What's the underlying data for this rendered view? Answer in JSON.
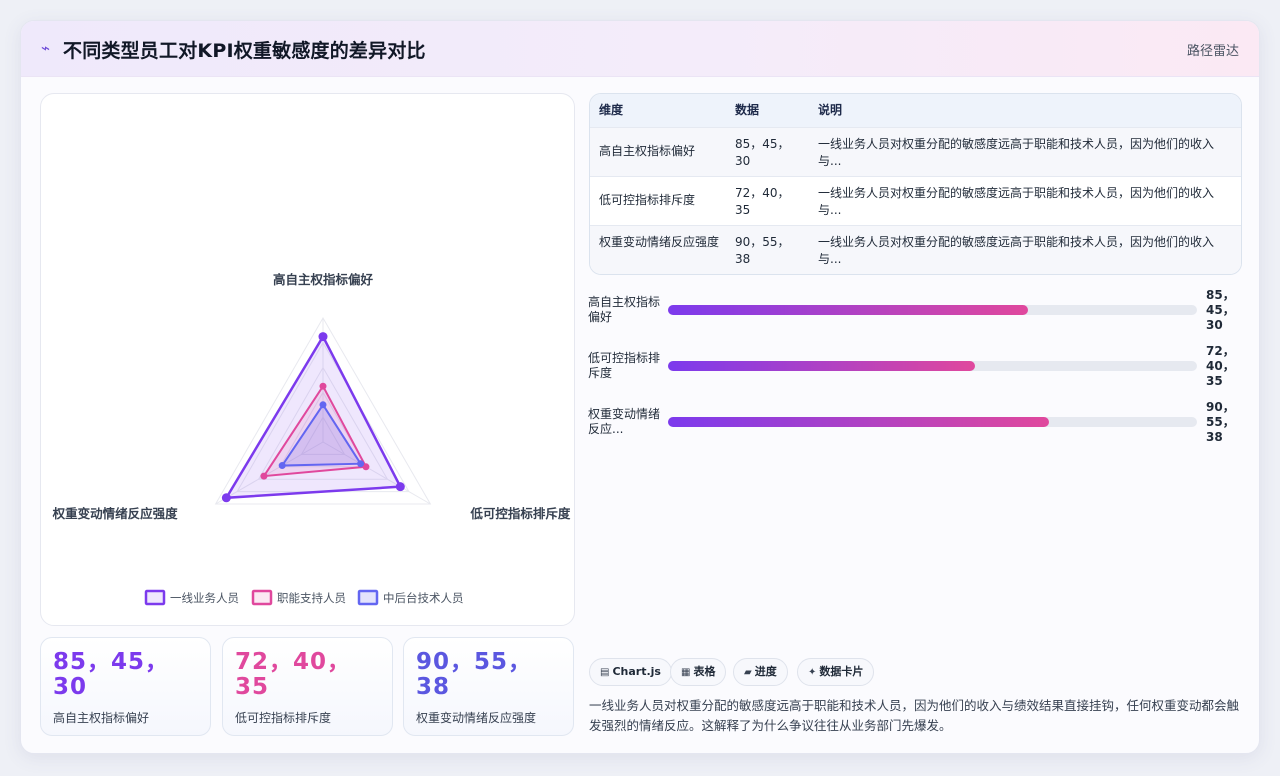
{
  "header": {
    "logo_icon": "pulse-icon",
    "title": "不同类型员工对KPI权重敏感度的差异对比",
    "tag": "路径雷达"
  },
  "chart_data": {
    "type": "radar",
    "axes": [
      "高自主权指标偏好",
      "低可控指标排斥度",
      "权重变动情绪反应强度"
    ],
    "range": [
      0,
      100
    ],
    "series": [
      {
        "name": "一线业务人员",
        "values": [
          85,
          72,
          90
        ],
        "color": "#7c3aed"
      },
      {
        "name": "职能支持人员",
        "values": [
          45,
          40,
          55
        ],
        "color": "#e0489d"
      },
      {
        "name": "中后台技术人员",
        "values": [
          30,
          35,
          38
        ],
        "color": "#6366f1"
      }
    ],
    "legend_position": "bottom"
  },
  "stats": [
    {
      "value": "85，45，30",
      "label": "高自主权指标偏好",
      "color": "#7c3aed"
    },
    {
      "value": "72，40，35",
      "label": "低可控指标排斥度",
      "color": "#e0489d"
    },
    {
      "value": "90，55，38",
      "label": "权重变动情绪反应强度",
      "color": "#5b57e0"
    }
  ],
  "table": {
    "headers": [
      "维度",
      "数据",
      "说明"
    ],
    "rows": [
      {
        "dim": "高自主权指标偏好",
        "data": "85，45，30",
        "desc": "一线业务人员对权重分配的敏感度远高于职能和技术人员，因为他们的收入与..."
      },
      {
        "dim": "低可控指标排斥度",
        "data": "72，40，35",
        "desc": "一线业务人员对权重分配的敏感度远高于职能和技术人员，因为他们的收入与..."
      },
      {
        "dim": "权重变动情绪反应强度",
        "data": "90，55，38",
        "desc": "一线业务人员对权重分配的敏感度远高于职能和技术人员，因为他们的收入与..."
      }
    ]
  },
  "progress": [
    {
      "label": "高自主权指标偏好",
      "value": "85，45，30",
      "fill_pct": 68
    },
    {
      "label": "低可控指标排斥度",
      "value": "72，40，35",
      "fill_pct": 58
    },
    {
      "label": "权重变动情绪反应...",
      "value": "90，55，38",
      "fill_pct": 72
    }
  ],
  "chips": [
    {
      "icon": "chart-icon",
      "glyph": "▤",
      "label": "Chart.js"
    },
    {
      "icon": "table-icon",
      "glyph": "▦",
      "label": "表格"
    },
    {
      "icon": "progress-icon",
      "glyph": "▰",
      "label": "进度"
    },
    {
      "icon": "card-icon",
      "glyph": "✦",
      "label": "数据卡片"
    }
  ],
  "summary": "一线业务人员对权重分配的敏感度远高于职能和技术人员，因为他们的收入与绩效结果直接挂钩，任何权重变动都会触发强烈的情绪反应。这解释了为什么争议往往从业务部门先爆发。"
}
